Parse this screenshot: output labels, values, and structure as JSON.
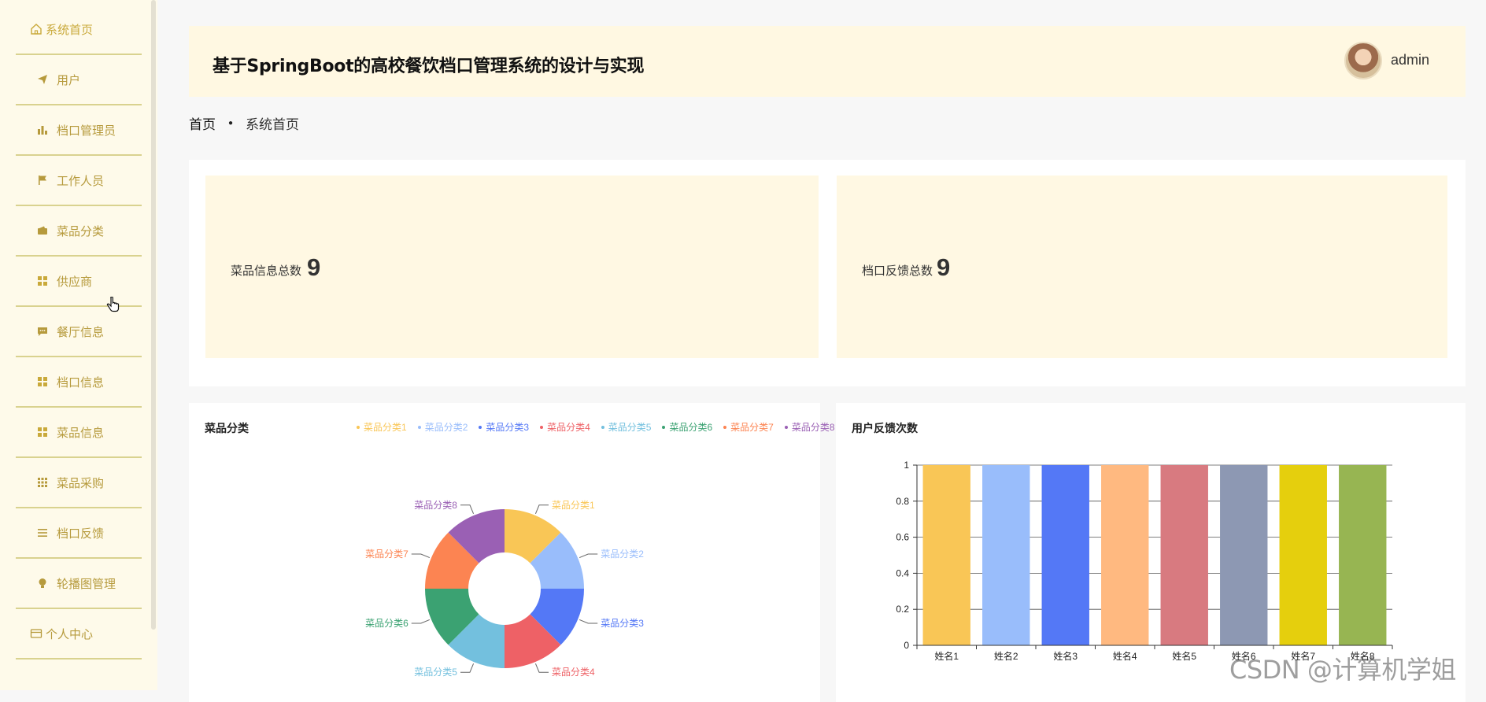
{
  "sidebar": {
    "items": [
      {
        "label": "系统首页",
        "icon": "home-icon"
      },
      {
        "label": "用户",
        "icon": "paper-plane-icon"
      },
      {
        "label": "档口管理员",
        "icon": "bar-chart-icon"
      },
      {
        "label": "工作人员",
        "icon": "flag-icon"
      },
      {
        "label": "菜品分类",
        "icon": "wallet-icon"
      },
      {
        "label": "供应商",
        "icon": "grid-icon"
      },
      {
        "label": "餐厅信息",
        "icon": "message-icon"
      },
      {
        "label": "档口信息",
        "icon": "grid-icon"
      },
      {
        "label": "菜品信息",
        "icon": "grid-icon"
      },
      {
        "label": "菜品采购",
        "icon": "apps-icon"
      },
      {
        "label": "档口反馈",
        "icon": "list-icon"
      },
      {
        "label": "轮播图管理",
        "icon": "bulb-icon"
      },
      {
        "label": "个人中心",
        "icon": "card-icon"
      }
    ]
  },
  "header": {
    "title": "基于SpringBoot的高校餐饮档口管理系统的设计与实现",
    "username": "admin"
  },
  "breadcrumb": {
    "home": "首页",
    "current": "系统首页"
  },
  "stats": [
    {
      "label": "菜品信息总数",
      "value": "9"
    },
    {
      "label": "档口反馈总数",
      "value": "9"
    }
  ],
  "colors": {
    "accent": "#c9a93a",
    "menu_border": "#d9d28f",
    "card_bg": "#fff8e3"
  },
  "watermark": "CSDN @计算机学姐",
  "chart_data": [
    {
      "type": "pie",
      "title": "菜品分类",
      "donut": true,
      "legend_position": "top-right",
      "categories": [
        "菜品分类1",
        "菜品分类2",
        "菜品分类3",
        "菜品分类4",
        "菜品分类5",
        "菜品分类6",
        "菜品分类7",
        "菜品分类8"
      ],
      "values": [
        1,
        1,
        1,
        1,
        1,
        1,
        1,
        1
      ],
      "colors": [
        "#f9c656",
        "#99bdfb",
        "#5478f6",
        "#ee6166",
        "#73c0de",
        "#3ba272",
        "#fc8452",
        "#9a60b4"
      ]
    },
    {
      "type": "bar",
      "title": "用户反馈次数",
      "categories": [
        "姓名1",
        "姓名2",
        "姓名3",
        "姓名4",
        "姓名5",
        "姓名6",
        "姓名7",
        "姓名8"
      ],
      "values": [
        1,
        1,
        1,
        1,
        1,
        1,
        1,
        1
      ],
      "ylim": [
        0,
        1
      ],
      "yticks": [
        "0",
        "0.2",
        "0.4",
        "0.6",
        "0.8",
        "1"
      ],
      "grid": true,
      "colors": [
        "#f9c656",
        "#99bdfb",
        "#5478f6",
        "#ffb980",
        "#d87a80",
        "#8d98b3",
        "#e5cf0d",
        "#97b552"
      ]
    }
  ]
}
